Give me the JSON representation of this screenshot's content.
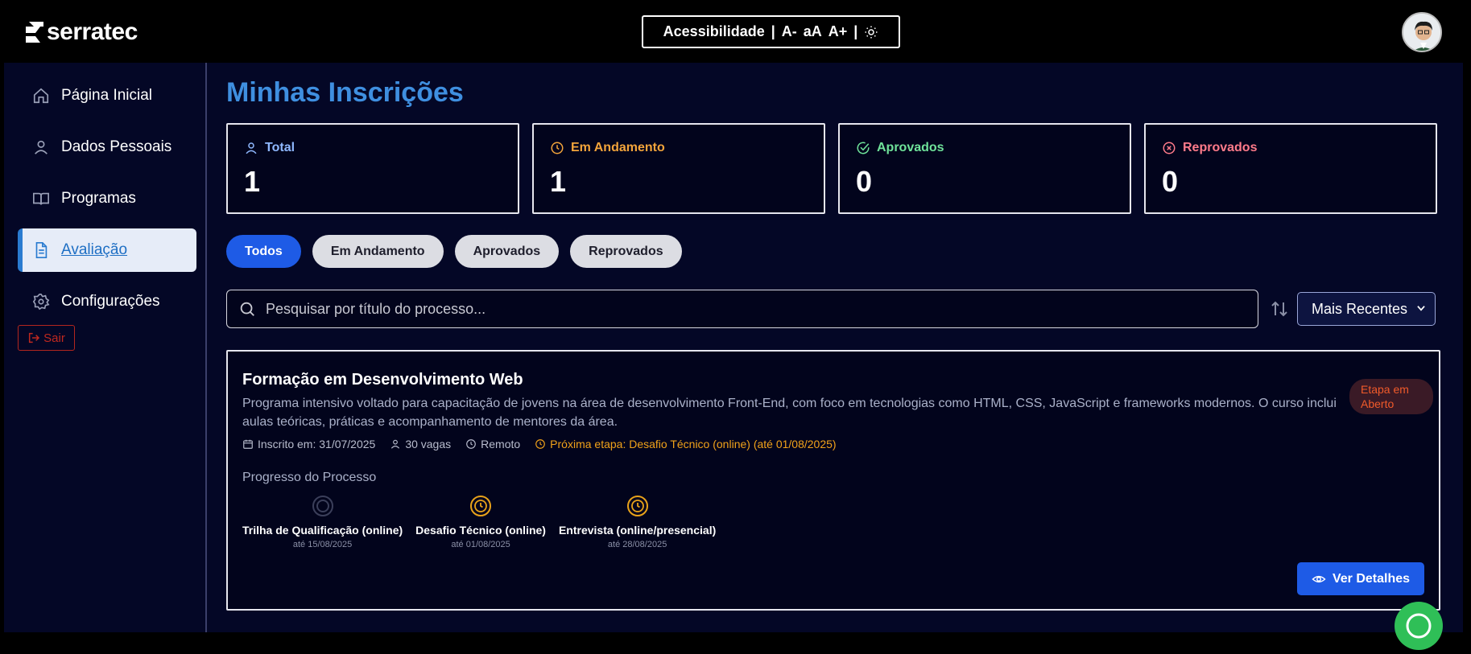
{
  "header": {
    "logo_text": "serratec",
    "accessibility": {
      "label": "Acessibilidade",
      "sep": "|",
      "decrease": "A-",
      "reset": "aA",
      "increase": "A+",
      "theme_icon": "sun-icon"
    },
    "avatar_icon": "user-avatar"
  },
  "sidebar": {
    "items": [
      {
        "label": "Página Inicial",
        "icon": "home-icon"
      },
      {
        "label": "Dados Pessoais",
        "icon": "user-icon"
      },
      {
        "label": "Programas",
        "icon": "book-icon"
      },
      {
        "label": "Avaliação",
        "icon": "document-icon",
        "active": true
      },
      {
        "label": "Configurações",
        "icon": "gear-icon"
      }
    ],
    "logout_label": "Sair"
  },
  "main": {
    "title": "Minhas Inscrições",
    "stats": [
      {
        "label": "Total",
        "value": "1",
        "color": "#8fb8ff",
        "icon": "user-icon"
      },
      {
        "label": "Em Andamento",
        "value": "1",
        "color": "#f3a43b",
        "icon": "clock-icon"
      },
      {
        "label": "Aprovados",
        "value": "0",
        "color": "#6fe39a",
        "icon": "check-circle-icon"
      },
      {
        "label": "Reprovados",
        "value": "0",
        "color": "#ff7b8a",
        "icon": "x-circle-icon"
      }
    ],
    "filters": [
      "Todos",
      "Em Andamento",
      "Aprovados",
      "Reprovados"
    ],
    "search": {
      "placeholder": "Pesquisar por título do processo..."
    },
    "sort": {
      "selected": "Mais Recentes"
    },
    "card": {
      "title": "Formação em Desenvolvimento Web",
      "description": "Programa intensivo voltado para capacitação de jovens na área de desenvolvimento Front-End, com foco em tecnologias como HTML, CSS, JavaScript e frameworks modernos. O curso inclui aulas teóricas, práticas e acompanhamento de mentores da área.",
      "badge_line1": "Etapa em",
      "badge_line2": "Aberto",
      "enrolled": "Inscrito em: 31/07/2025",
      "vacancies": "30 vagas",
      "mode": "Remoto",
      "next_step": "Próxima etapa: Desafio Técnico (online) (até 01/08/2025)",
      "progress_label": "Progresso do Processo",
      "steps": [
        {
          "name": "Trilha de Qualificação (online)",
          "date": "até 15/08/2025",
          "state": "pending"
        },
        {
          "name": "Desafio Técnico (online)",
          "date": "até 01/08/2025",
          "state": "in-progress"
        },
        {
          "name": "Entrevista (online/presencial)",
          "date": "até 28/08/2025",
          "state": "in-progress"
        }
      ],
      "details_button": "Ver Detalhes"
    }
  }
}
